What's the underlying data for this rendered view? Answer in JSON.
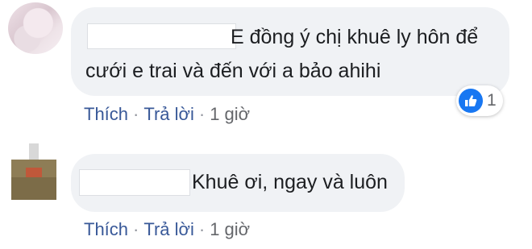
{
  "comments": [
    {
      "text_line1": "E đồng ý chị khuê ly hôn để",
      "text_line2": "cưới e trai và đến với a bảo ahihi",
      "actions": {
        "like": "Thích",
        "reply": "Trả lời",
        "time": "1 giờ",
        "separator": "·"
      },
      "reaction": {
        "icon": "thumbs-up-icon",
        "count": "1",
        "color": "#1877f2"
      }
    },
    {
      "text_line1": "Khuê ơi, ngay và luôn",
      "actions": {
        "like": "Thích",
        "reply": "Trả lời",
        "time": "1 giờ",
        "separator": "·"
      }
    }
  ]
}
